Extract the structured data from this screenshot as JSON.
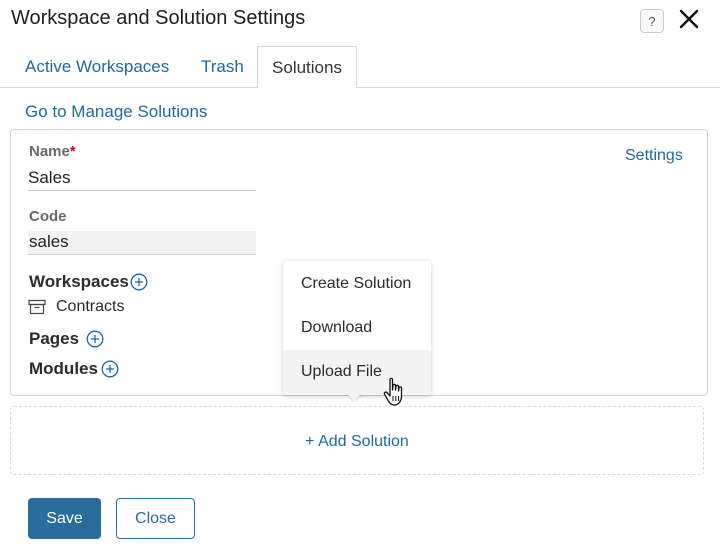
{
  "dialog": {
    "title": "Workspace and Solution Settings",
    "help_label": "?"
  },
  "tabs": [
    {
      "label": "Active Workspaces",
      "active": false
    },
    {
      "label": "Trash",
      "active": false
    },
    {
      "label": "Solutions",
      "active": true
    }
  ],
  "manage_link": "Go to Manage Solutions",
  "solution": {
    "settings_link": "Settings",
    "name_label": "Name",
    "required_mark": "*",
    "name_value": "Sales",
    "code_label": "Code",
    "code_value": "sales",
    "workspaces_label": "Workspaces",
    "workspace_items": [
      "Contracts"
    ],
    "pages_label": "Pages",
    "modules_label": "Modules"
  },
  "menu": {
    "items": [
      {
        "label": "Create Solution"
      },
      {
        "label": "Download"
      },
      {
        "label": "Upload File",
        "hovered": true
      }
    ]
  },
  "add_solution_label": "+ Add Solution",
  "footer": {
    "save_label": "Save",
    "close_label": "Close"
  },
  "colors": {
    "accent": "#1d6a9e",
    "primary_button": "#2a6c9c",
    "required": "#d0021b"
  }
}
